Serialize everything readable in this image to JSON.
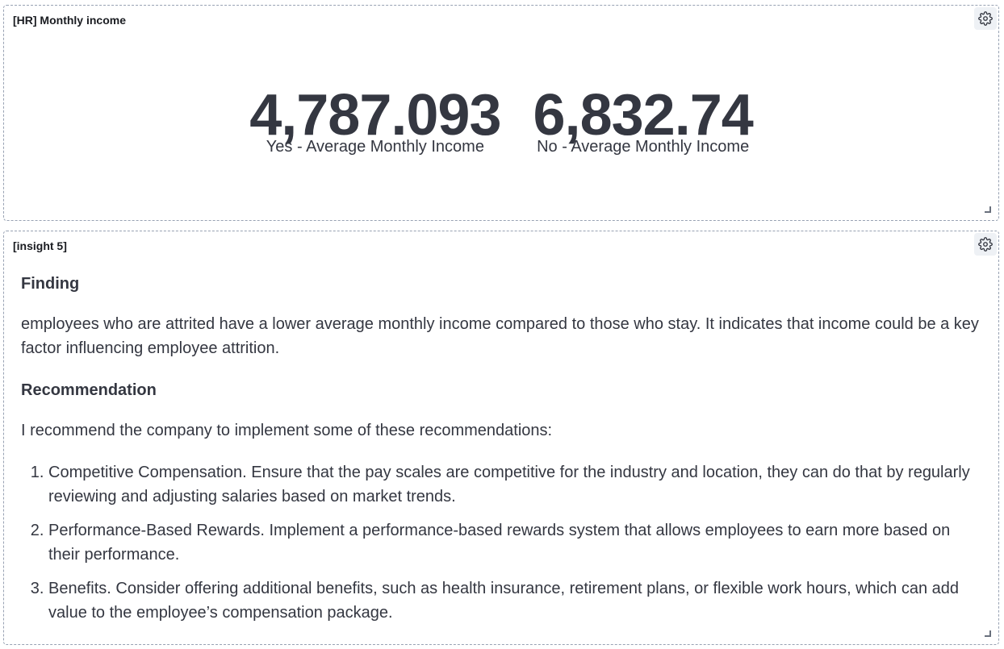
{
  "panel1": {
    "title": "[HR] Monthly income",
    "metrics": [
      {
        "value": "4,787.093",
        "label": "Yes - Average Monthly Income"
      },
      {
        "value": "6,832.74",
        "label": "No - Average Monthly Income"
      }
    ]
  },
  "panel2": {
    "title": "[insight 5]",
    "finding_heading": "Finding",
    "finding_text": "employees who are attrited have a lower average monthly income compared to those who stay. It indicates that income could be a key factor influencing employee attrition.",
    "recommendation_heading": "Recommendation",
    "recommendation_intro": "I recommend the company to implement some of these recommendations:",
    "recommendations": [
      "Competitive Compensation. Ensure that the pay scales are competitive for the industry and location, they can do that by regularly reviewing and adjusting salaries based on market trends.",
      "Performance-Based Rewards. Implement a performance-based rewards system that allows employees to earn more based on their performance.",
      "Benefits. Consider offering additional benefits, such as health insurance, retirement plans, or flexible work hours, which can add value to the employee’s compensation package."
    ]
  },
  "icons": {
    "panel_options": "gear-icon",
    "resize": "resize-handle-icon"
  },
  "colors": {
    "text": "#343741",
    "border": "#98a2b3",
    "gear_bg": "#eef1f5"
  }
}
